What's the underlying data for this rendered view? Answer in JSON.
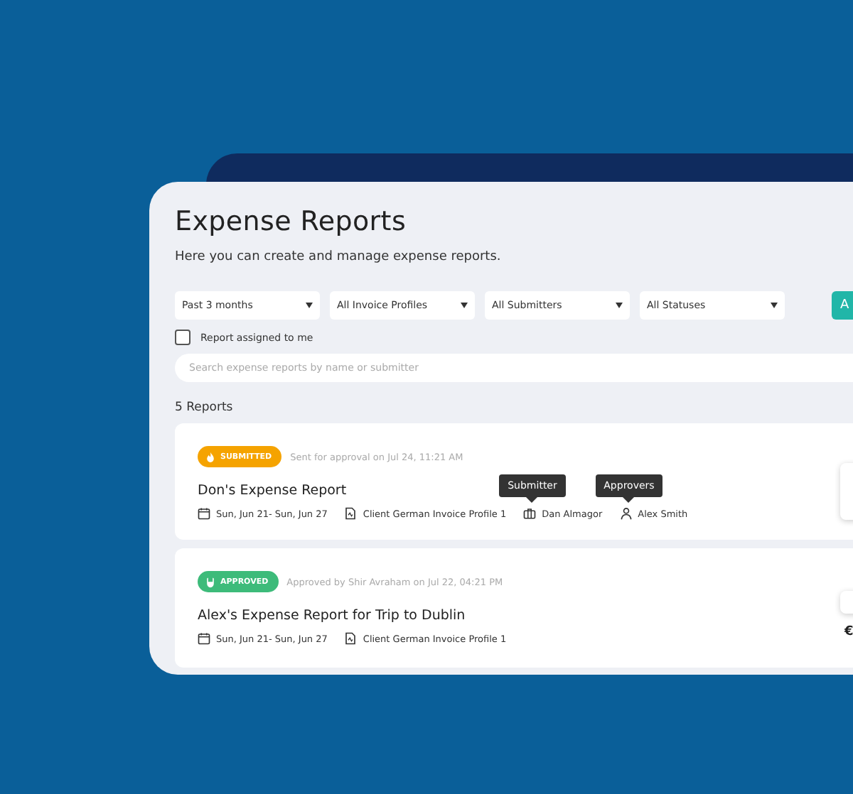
{
  "header": {
    "title": "Expense Reports",
    "subtitle": "Here you can create and manage expense reports."
  },
  "filters": [
    "Past 3 months",
    "All Invoice Profiles",
    "All Submitters",
    "All Statuses"
  ],
  "add_button": {
    "label": "A"
  },
  "assigned_filter": {
    "label": "Report assigned to me",
    "checked": false
  },
  "search": {
    "placeholder": "Search expense reports by name or submitter"
  },
  "count": "5 Reports",
  "reports": [
    {
      "status": {
        "kind": "submitted",
        "label": "SUBMITTED",
        "color": "#f5a300"
      },
      "note": "Sent for approval on Jul 24, 11:21 AM",
      "title": "Don's Expense Report",
      "meta": [
        {
          "kind": "dates",
          "text": "Sun, Jun 21- Sun, Jun 27"
        },
        {
          "kind": "profile",
          "text": "Client German Invoice Profile 1"
        },
        {
          "kind": "submitter",
          "text": "Dan Almagor",
          "tooltip": "Submitter"
        },
        {
          "kind": "approver",
          "text": "Alex Smith",
          "tooltip": "Approvers"
        }
      ]
    },
    {
      "status": {
        "kind": "approved",
        "label": "APPROVED",
        "color": "#3dbb7a"
      },
      "note": "Approved by Shir Avraham on Jul 22, 04:21 PM",
      "title": "Alex's Expense Report for Trip to Dublin",
      "amount": "€",
      "meta": [
        {
          "kind": "dates",
          "text": "Sun, Jun 21- Sun, Jun 27"
        },
        {
          "kind": "profile",
          "text": "Client German Invoice Profile 1"
        }
      ]
    }
  ]
}
